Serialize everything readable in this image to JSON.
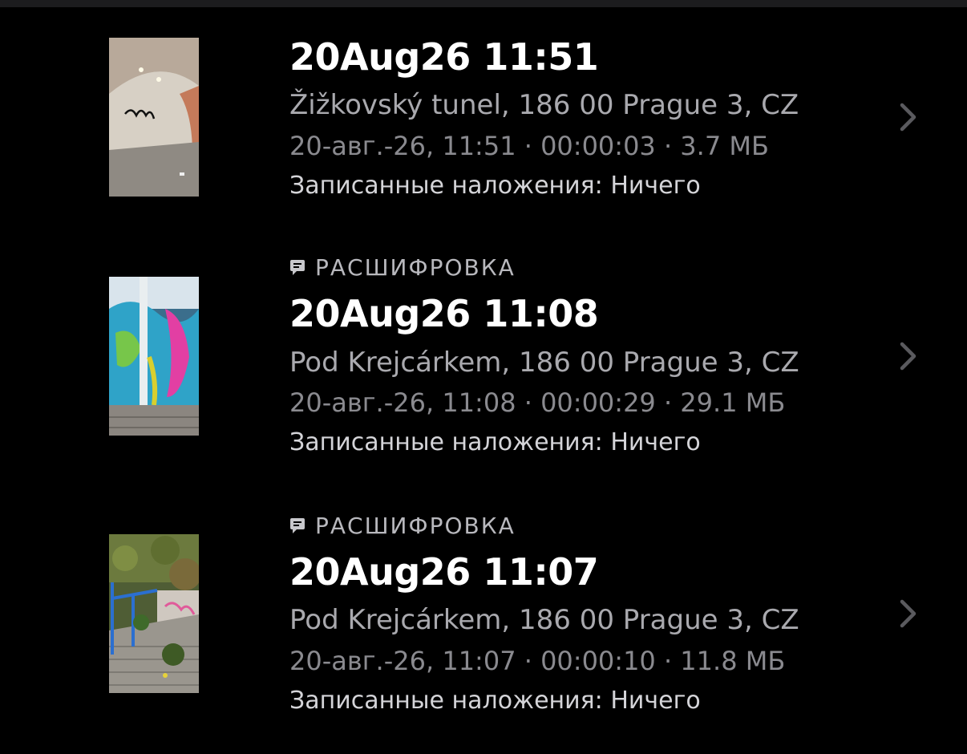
{
  "colors": {
    "background": "#000000",
    "title": "#ffffff",
    "subtle": "#8a8a8f",
    "chevron": "#5a5a5e"
  },
  "recordings": [
    {
      "tag": "",
      "title": "20Aug26 11:51",
      "address": "Žižkovský tunel, 186 00 Prague 3, CZ",
      "meta": "20-авг.-26, 11:51 · 00:00:03 · 3.7 МБ",
      "overlays": "Записанные наложения: Ничего",
      "thumbnail_icon": "tunnel-thumbnail"
    },
    {
      "tag": "РАСШИФРОВКА",
      "tag_icon": "transcript-bubble-icon",
      "title": "20Aug26 11:08",
      "address": "Pod Krejcárkem, 186 00 Prague 3, CZ",
      "meta": "20-авг.-26, 11:08 · 00:00:29 · 29.1 МБ",
      "overlays": "Записанные наложения: Ничего",
      "thumbnail_icon": "graffiti-thumbnail"
    },
    {
      "tag": "РАСШИФРОВКА",
      "tag_icon": "transcript-bubble-icon",
      "title": "20Aug26 11:07",
      "address": "Pod Krejcárkem, 186 00 Prague 3, CZ",
      "meta": "20-авг.-26, 11:07 · 00:00:10 · 11.8 МБ",
      "overlays": "Записанные наложения: Ничего",
      "thumbnail_icon": "stairs-thumbnail"
    }
  ]
}
